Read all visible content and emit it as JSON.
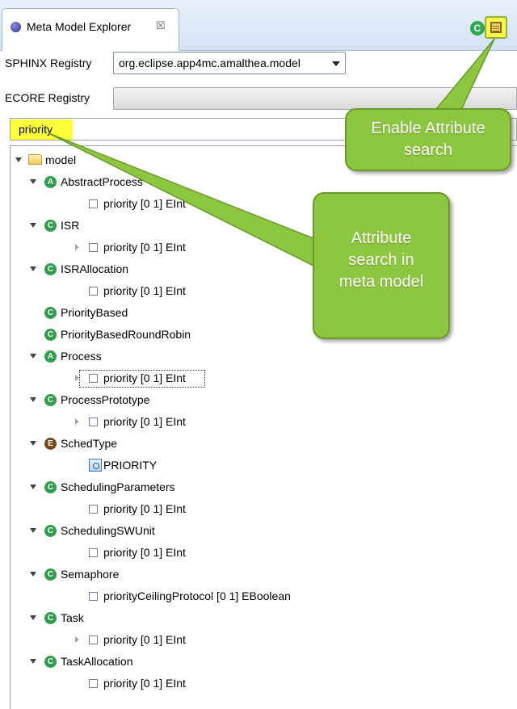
{
  "view": {
    "tab_title": "Meta Model Explorer",
    "tab_close": "☒",
    "enable_icon_letter": "C"
  },
  "sphinx": {
    "label": "SPHINX Registry",
    "value": "org.eclipse.app4mc.amalthea.model"
  },
  "ecore": {
    "label": "ECORE Registry",
    "value": ""
  },
  "search": {
    "value": "priority"
  },
  "tree": [
    {
      "text": "model",
      "icon": "folder",
      "level": 0,
      "exp": "down"
    },
    {
      "text": "AbstractProcess",
      "icon": "A",
      "level": 1,
      "exp": "down"
    },
    {
      "text": "priority  [0 1] EInt",
      "icon": "attr",
      "level": 2,
      "exp": ""
    },
    {
      "text": "ISR",
      "icon": "C",
      "level": 1,
      "exp": "down"
    },
    {
      "text": "priority  [0 1] EInt",
      "icon": "attr",
      "level": 2,
      "exp": "right"
    },
    {
      "text": "ISRAllocation",
      "icon": "C",
      "level": 1,
      "exp": "down"
    },
    {
      "text": "priority  [0 1] EInt",
      "icon": "attr",
      "level": 2,
      "exp": ""
    },
    {
      "text": "PriorityBased",
      "icon": "C",
      "level": 1,
      "exp": ""
    },
    {
      "text": "PriorityBasedRoundRobin",
      "icon": "C",
      "level": 1,
      "exp": ""
    },
    {
      "text": "Process",
      "icon": "A",
      "level": 1,
      "exp": "down"
    },
    {
      "text": "priority  [0 1] EInt",
      "icon": "attr",
      "level": 2,
      "exp": "right"
    },
    {
      "text": "ProcessPrototype",
      "icon": "C",
      "level": 1,
      "exp": "down"
    },
    {
      "text": "priority  [0 1] EInt",
      "icon": "attr",
      "level": 2,
      "exp": "right"
    },
    {
      "text": "SchedType",
      "icon": "E",
      "level": 1,
      "exp": "down"
    },
    {
      "text": "PRIORITY",
      "icon": "literal",
      "level": 2,
      "exp": ""
    },
    {
      "text": "SchedulingParameters",
      "icon": "C",
      "level": 1,
      "exp": "down"
    },
    {
      "text": "priority  [0 1] EInt",
      "icon": "attr",
      "level": 2,
      "exp": ""
    },
    {
      "text": "SchedulingSWUnit",
      "icon": "C",
      "level": 1,
      "exp": "down"
    },
    {
      "text": "priority  [0 1] EInt",
      "icon": "attr",
      "level": 2,
      "exp": ""
    },
    {
      "text": "Semaphore",
      "icon": "C",
      "level": 1,
      "exp": "down"
    },
    {
      "text": "priorityCeilingProtocol  [0 1] EBoolean",
      "icon": "attr",
      "level": 2,
      "exp": ""
    },
    {
      "text": "Task",
      "icon": "C",
      "level": 1,
      "exp": "down"
    },
    {
      "text": "priority  [0 1] EInt",
      "icon": "attr",
      "level": 2,
      "exp": "right"
    },
    {
      "text": "TaskAllocation",
      "icon": "C",
      "level": 1,
      "exp": "down"
    },
    {
      "text": "priority  [0 1] EInt",
      "icon": "attr",
      "level": 2,
      "exp": ""
    }
  ],
  "callouts": {
    "enable": [
      "Enable Attribute",
      "search"
    ],
    "attribute": [
      "Attribute",
      "search in",
      "meta model"
    ]
  },
  "colors": {
    "callout": "#8dc63f",
    "highlight": "#ffff3a",
    "class_icon": "#2e9e4a",
    "enum_icon": "#7a4a1a"
  }
}
